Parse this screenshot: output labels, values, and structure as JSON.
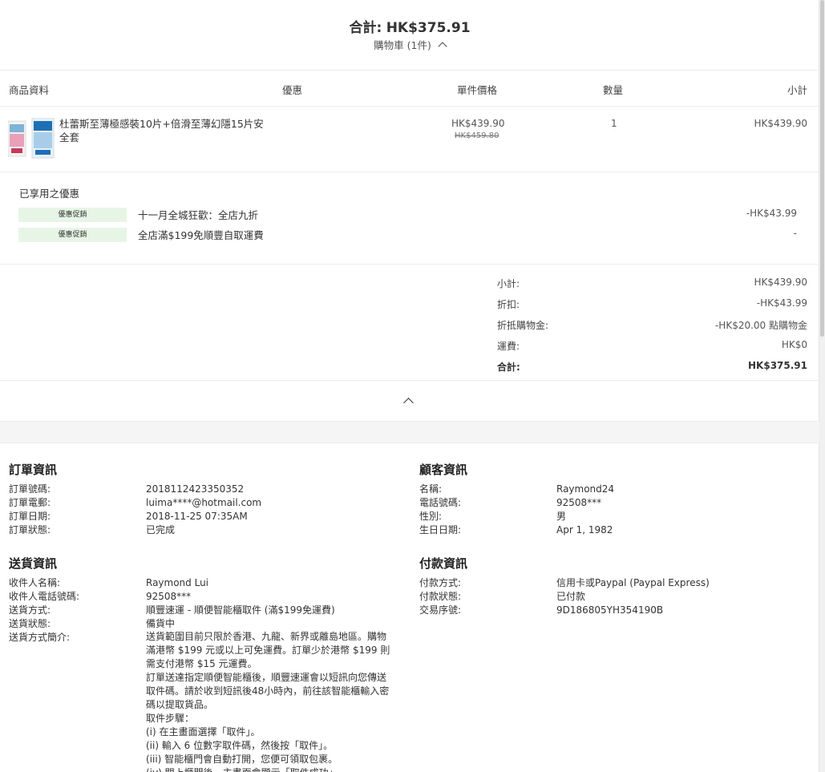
{
  "summary": {
    "total_label": "合計:",
    "total_value": "HK$375.91",
    "cart_label": "購物車 (1件)"
  },
  "table": {
    "headers": [
      "商品資料",
      "優惠",
      "單件價格",
      "數量",
      "小計"
    ],
    "item": {
      "name": "杜蕾斯至薄極感裝10片+倍滑至薄幻隱15片安全套",
      "price": "HK$439.90",
      "original_price": "HK$459.80",
      "quantity": "1",
      "subtotal": "HK$439.90"
    }
  },
  "discounts": {
    "title": "已享用之優惠",
    "items": [
      {
        "badge": "優惠促銷",
        "name": "十一月全城狂歡：全店九折",
        "amount": "-HK$43.99"
      },
      {
        "badge": "優惠促銷",
        "name": "全店滿$199免順豐自取運費",
        "amount": "-"
      }
    ]
  },
  "totals": [
    {
      "label": "小計:",
      "value": "HK$439.90"
    },
    {
      "label": "折扣:",
      "value": "-HK$43.99"
    },
    {
      "label": "折抵購物金:",
      "value": "-HK$20.00 點購物金"
    },
    {
      "label": "運費:",
      "value": "HK$0"
    },
    {
      "label": "合計:",
      "value": "HK$375.91"
    }
  ],
  "order_info": {
    "title": "訂單資訊",
    "rows": [
      {
        "label": "訂單號碼:",
        "value": "2018112423350352"
      },
      {
        "label": "訂單電郵:",
        "value": "luima****@hotmail.com"
      },
      {
        "label": "訂單日期:",
        "value": "2018-11-25 07:35AM"
      },
      {
        "label": "訂單狀態:",
        "value": "已完成"
      }
    ]
  },
  "customer_info": {
    "title": "顧客資訊",
    "rows": [
      {
        "label": "名稱:",
        "value": "Raymond24"
      },
      {
        "label": "電話號碼:",
        "value": "92508***"
      },
      {
        "label": "性別:",
        "value": "男"
      },
      {
        "label": "生日日期:",
        "value": "Apr 1, 1982"
      }
    ]
  },
  "delivery_info": {
    "title": "送貨資訊",
    "rows": [
      {
        "label": "收件人名稱:",
        "value": "Raymond Lui"
      },
      {
        "label": "收件人電話號碼:",
        "value": "92508***"
      },
      {
        "label": "送貨方式:",
        "value": "順豐速運 - 順便智能櫃取件 (滿$199免運費)"
      },
      {
        "label": "送貨狀態:",
        "value": "備貨中"
      },
      {
        "label": "送貨方式簡介:",
        "value": ""
      }
    ],
    "description": "送貨範圍目前只限於香港、九龍、新界或離島地區。購物滿港幣 $199 元或以上可免運費。訂單少於港幣 $199 則需支付港幣 $15 元運費。\n訂單送達指定順便智能櫃後，順豐速運會以短訊向您傳送取件碼。請於收到短訊後48小時內，前往該智能櫃輸入密碼以提取貨品。\n取件步驟：\n(i) 在主畫面選擇「取件」。\n(ii) 輸入 6 位數字取件碼，然後按「取件」。\n(iii) 智能櫃門會自動打開，您便可領取包裹。\n(iv) 關上櫃門後，主畫面會顯示「取件成功」。"
  },
  "payment_info": {
    "title": "付款資訊",
    "rows": [
      {
        "label": "付款方式:",
        "value": "信用卡或Paypal (Paypal Express)"
      },
      {
        "label": "付款狀態:",
        "value": "已付款"
      },
      {
        "label": "交易序號:",
        "value": "9D186805YH354190B"
      }
    ]
  },
  "colors": {
    "badge_bg": "#e7f5e7",
    "rule": "#ececec"
  }
}
